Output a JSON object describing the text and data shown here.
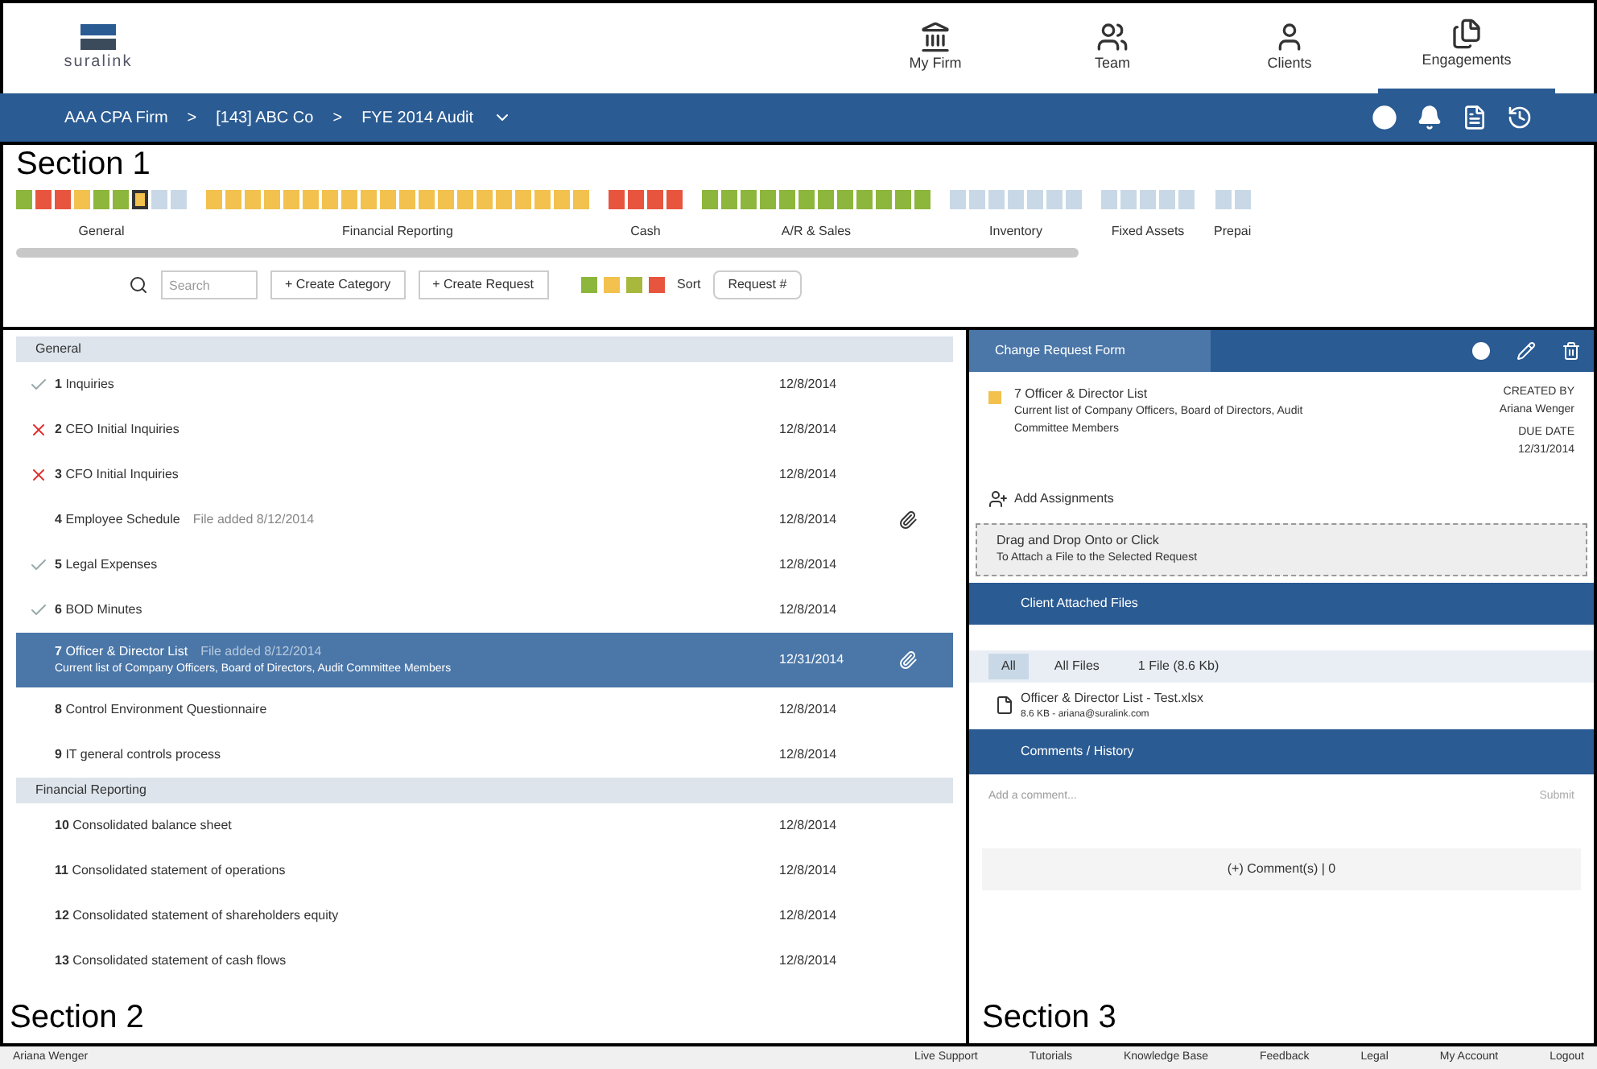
{
  "header": {
    "logo": "suralink",
    "nav": [
      {
        "label": "My Firm",
        "kind": "bank",
        "selected": false
      },
      {
        "label": "Team",
        "kind": "team",
        "selected": false
      },
      {
        "label": "Clients",
        "kind": "person",
        "selected": false
      },
      {
        "label": "Engagements",
        "kind": "docs",
        "selected": true
      }
    ]
  },
  "breadcrumb": [
    "AAA CPA Firm",
    "[143] ABC Co",
    "FYE 2014 Audit"
  ],
  "breadcrumb_separator": ">",
  "section_labels": [
    "Section 1",
    "Section 2",
    "Section 3"
  ],
  "progress": [
    {
      "label": "General",
      "cells": [
        {
          "color": "#8db63c",
          "selected": false
        },
        {
          "color": "#e8553f",
          "selected": false
        },
        {
          "color": "#e8553f",
          "selected": false
        },
        {
          "color": "#f2c14e",
          "selected": false
        },
        {
          "color": "#8db63c",
          "selected": false
        },
        {
          "color": "#8db63c",
          "selected": false
        },
        {
          "color": "#f2c14e",
          "selected": true
        },
        {
          "color": "#c9d8e6",
          "selected": false
        },
        {
          "color": "#c9d8e6",
          "selected": false
        }
      ]
    },
    {
      "label": "Financial Reporting",
      "cells": [
        {
          "color": "#f2c14e",
          "selected": false
        },
        {
          "color": "#f2c14e",
          "selected": false
        },
        {
          "color": "#f2c14e",
          "selected": false
        },
        {
          "color": "#f2c14e",
          "selected": false
        },
        {
          "color": "#f2c14e",
          "selected": false
        },
        {
          "color": "#f2c14e",
          "selected": false
        },
        {
          "color": "#f2c14e",
          "selected": false
        },
        {
          "color": "#f2c14e",
          "selected": false
        },
        {
          "color": "#f2c14e",
          "selected": false
        },
        {
          "color": "#f2c14e",
          "selected": false
        },
        {
          "color": "#f2c14e",
          "selected": false
        },
        {
          "color": "#f2c14e",
          "selected": false
        },
        {
          "color": "#f2c14e",
          "selected": false
        },
        {
          "color": "#f2c14e",
          "selected": false
        },
        {
          "color": "#f2c14e",
          "selected": false
        },
        {
          "color": "#f2c14e",
          "selected": false
        },
        {
          "color": "#f2c14e",
          "selected": false
        },
        {
          "color": "#f2c14e",
          "selected": false
        },
        {
          "color": "#f2c14e",
          "selected": false
        },
        {
          "color": "#f2c14e",
          "selected": false
        }
      ]
    },
    {
      "label": "Cash",
      "cells": [
        {
          "color": "#e8553f",
          "selected": false
        },
        {
          "color": "#e8553f",
          "selected": false
        },
        {
          "color": "#e8553f",
          "selected": false
        },
        {
          "color": "#e8553f",
          "selected": false
        }
      ]
    },
    {
      "label": "A/R & Sales",
      "cells": [
        {
          "color": "#8db63c",
          "selected": false
        },
        {
          "color": "#8db63c",
          "selected": false
        },
        {
          "color": "#8db63c",
          "selected": false
        },
        {
          "color": "#8db63c",
          "selected": false
        },
        {
          "color": "#8db63c",
          "selected": false
        },
        {
          "color": "#8db63c",
          "selected": false
        },
        {
          "color": "#8db63c",
          "selected": false
        },
        {
          "color": "#8db63c",
          "selected": false
        },
        {
          "color": "#8db63c",
          "selected": false
        },
        {
          "color": "#8db63c",
          "selected": false
        },
        {
          "color": "#8db63c",
          "selected": false
        },
        {
          "color": "#8db63c",
          "selected": false
        }
      ]
    },
    {
      "label": "Inventory",
      "cells": [
        {
          "color": "#c9d8e6",
          "selected": false
        },
        {
          "color": "#c9d8e6",
          "selected": false
        },
        {
          "color": "#c9d8e6",
          "selected": false
        },
        {
          "color": "#c9d8e6",
          "selected": false
        },
        {
          "color": "#c9d8e6",
          "selected": false
        },
        {
          "color": "#c9d8e6",
          "selected": false
        },
        {
          "color": "#c9d8e6",
          "selected": false
        }
      ]
    },
    {
      "label": "Fixed Assets",
      "cells": [
        {
          "color": "#c9d8e6",
          "selected": false
        },
        {
          "color": "#c9d8e6",
          "selected": false
        },
        {
          "color": "#c9d8e6",
          "selected": false
        },
        {
          "color": "#c9d8e6",
          "selected": false
        },
        {
          "color": "#c9d8e6",
          "selected": false
        }
      ]
    },
    {
      "label": "Prepai",
      "cells": [
        {
          "color": "#c9d8e6",
          "selected": false
        },
        {
          "color": "#c9d8e6",
          "selected": false
        }
      ]
    }
  ],
  "toolbar": {
    "search_placeholder": "Search",
    "buttons": [
      "+ Create Category",
      "+ Create Request"
    ],
    "filters": [
      {
        "color": "#8db63c"
      },
      {
        "color": "#f2c14e"
      },
      {
        "color": "#a8b83c"
      },
      {
        "color": "#e8553f"
      }
    ],
    "sort_label": "Sort",
    "sort_value": "Request #"
  },
  "requests": [
    {
      "category": "General",
      "rows": [
        {
          "number": "1",
          "title": "Inquiries",
          "date": "12/8/2014",
          "kind": "done",
          "selected": false
        },
        {
          "number": "2",
          "title": "CEO Initial Inquiries",
          "date": "12/8/2014",
          "kind": "rejected",
          "selected": false
        },
        {
          "number": "3",
          "title": "CFO Initial Inquiries",
          "date": "12/8/2014",
          "kind": "rejected",
          "selected": false
        },
        {
          "number": "4",
          "title": "Employee Schedule",
          "note": "File added 8/12/2014",
          "date": "12/8/2014",
          "kind": "open",
          "attachment": true,
          "selected": false
        },
        {
          "number": "5",
          "title": "Legal Expenses",
          "date": "12/8/2014",
          "kind": "done",
          "selected": false
        },
        {
          "number": "6",
          "title": "BOD Minutes",
          "date": "12/8/2014",
          "kind": "done",
          "selected": false
        },
        {
          "number": "7",
          "title": "Officer & Director List",
          "note": "File added 8/12/2014",
          "description": "Current list of Company Officers, Board of Directors, Audit Committee Members",
          "date": "12/31/2014",
          "kind": "open",
          "attachment": true,
          "selected": true
        },
        {
          "number": "8",
          "title": "Control Environment Questionnaire",
          "date": "12/8/2014",
          "kind": "open",
          "selected": false
        },
        {
          "number": "9",
          "title": "IT general controls process",
          "date": "12/8/2014",
          "kind": "open",
          "selected": false
        }
      ]
    },
    {
      "category": "Financial Reporting",
      "rows": [
        {
          "number": "10",
          "title": "Consolidated balance sheet",
          "date": "12/8/2014",
          "kind": "open",
          "selected": false
        },
        {
          "number": "11",
          "title": "Consolidated statement of operations",
          "date": "12/8/2014",
          "kind": "open",
          "selected": false
        },
        {
          "number": "12",
          "title": "Consolidated statement of shareholders equity",
          "date": "12/8/2014",
          "kind": "open",
          "selected": false
        },
        {
          "number": "13",
          "title": "Consolidated statement of cash flows",
          "date": "12/8/2014",
          "kind": "open",
          "selected": false
        }
      ]
    }
  ],
  "detail": {
    "tab": "Change Request Form",
    "title": "7 Officer & Director List",
    "description": "Current list of Company Officers, Board of Directors, Audit Committee Members",
    "created_by_label": "CREATED BY",
    "created_by": "Ariana Wenger",
    "due_label": "DUE DATE",
    "due": "12/31/2014",
    "add_assignments": "Add Assignments",
    "drop_title": "Drag and Drop Onto or Click",
    "drop_hint": "To Attach a File to the Selected Request",
    "files_header": "Client Attached Files",
    "file_tabs": [
      {
        "label": "All",
        "selected": true
      },
      {
        "label": "All Files",
        "selected": false
      },
      {
        "label": "1 File (8.6 Kb)",
        "selected": false
      }
    ],
    "file_name": "Officer & Director List - Test.xlsx",
    "file_meta": "8.6 KB - ariana@suralink.com",
    "comments_header": "Comments / History",
    "comment_placeholder": "Add a comment...",
    "comment_button": "Submit",
    "comment_count": "(+) Comment(s) | 0"
  },
  "footer": {
    "user": "Ariana Wenger",
    "links": [
      "Live Support",
      "Tutorials",
      "Knowledge Base",
      "Feedback",
      "Legal",
      "My Account",
      "Logout"
    ]
  }
}
